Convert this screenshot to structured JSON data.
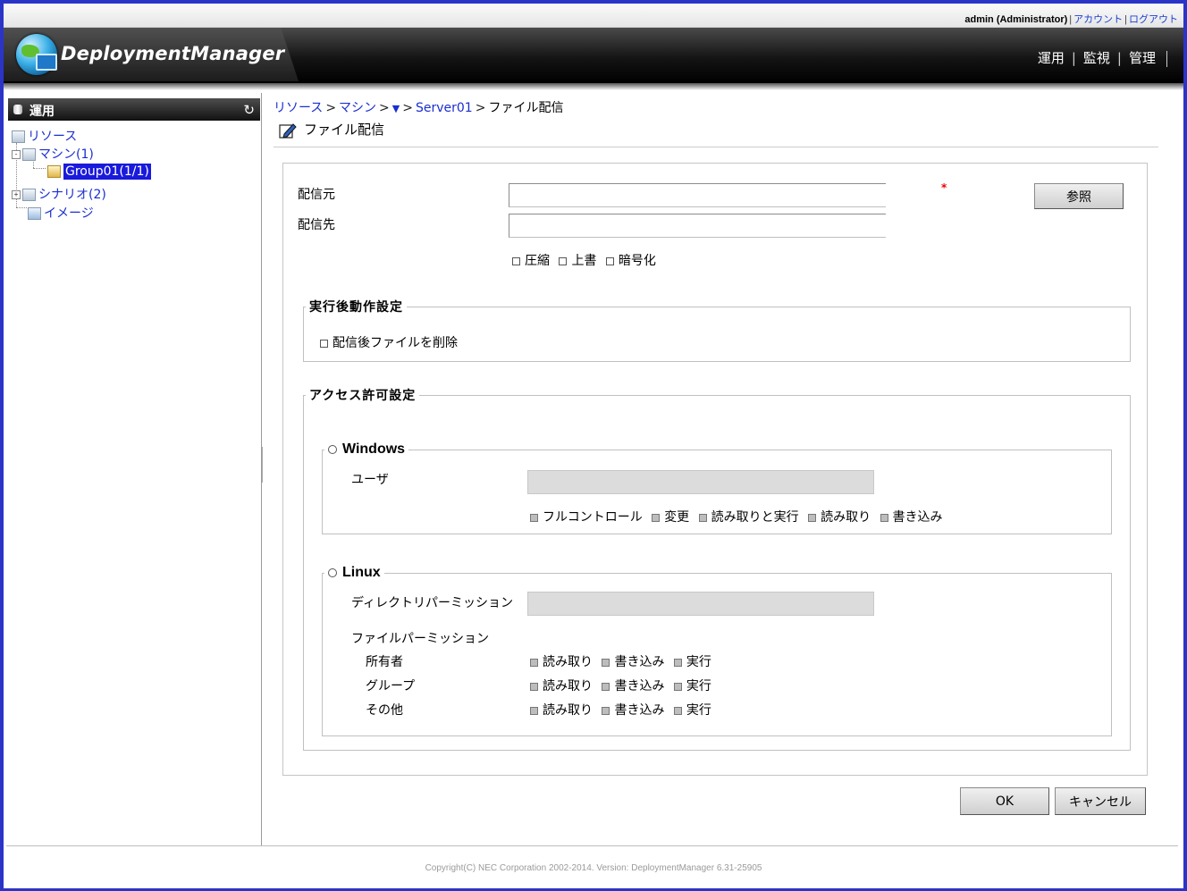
{
  "header": {
    "user": "admin (Administrator)",
    "account_link": "アカウント",
    "logout_link": "ログアウト",
    "logo_text": "DeploymentManager",
    "menu": [
      "運用",
      "監視",
      "管理"
    ]
  },
  "sidebar": {
    "title": "運用",
    "tree": {
      "resource": "リソース",
      "machine": "マシン(1)",
      "group": "Group01(1/1)",
      "scenario": "シナリオ(2)",
      "image": "イメージ"
    }
  },
  "breadcrumb": {
    "items": [
      "リソース",
      "マシン",
      "▼",
      "Server01",
      "ファイル配信"
    ],
    "separator": ">"
  },
  "page": {
    "title": "ファイル配信"
  },
  "form": {
    "source_label": "配信元",
    "source_value": "",
    "dest_label": "配信先",
    "dest_value": "",
    "required_mark": "*",
    "browse_button": "参照",
    "options": [
      "圧縮",
      "上書",
      "暗号化"
    ],
    "post_action": {
      "legend": "実行後動作設定",
      "delete_after": "配信後ファイルを削除"
    },
    "access": {
      "legend": "アクセス許可設定",
      "windows": {
        "label": "Windows",
        "user_label": "ユーザ",
        "user_value": "",
        "permissions": [
          "フルコントロール",
          "変更",
          "読み取りと実行",
          "読み取り",
          "書き込み"
        ]
      },
      "linux": {
        "label": "Linux",
        "dir_perm_label": "ディレクトリパーミッション",
        "dir_perm_value": "",
        "file_perm_label": "ファイルパーミッション",
        "rows": [
          {
            "label": "所有者",
            "perms": [
              "読み取り",
              "書き込み",
              "実行"
            ]
          },
          {
            "label": "グループ",
            "perms": [
              "読み取り",
              "書き込み",
              "実行"
            ]
          },
          {
            "label": "その他",
            "perms": [
              "読み取り",
              "書き込み",
              "実行"
            ]
          }
        ]
      }
    }
  },
  "actions": {
    "ok": "OK",
    "cancel": "キャンセル"
  },
  "footer": {
    "copyright": "Copyright(C) NEC Corporation 2002-2014. Version: DeploymentManager 6.31-25905"
  },
  "colors": {
    "frame": "#2a35c8",
    "link": "#1a2fd0",
    "selected": "#1a1adc",
    "required": "#e00000"
  }
}
